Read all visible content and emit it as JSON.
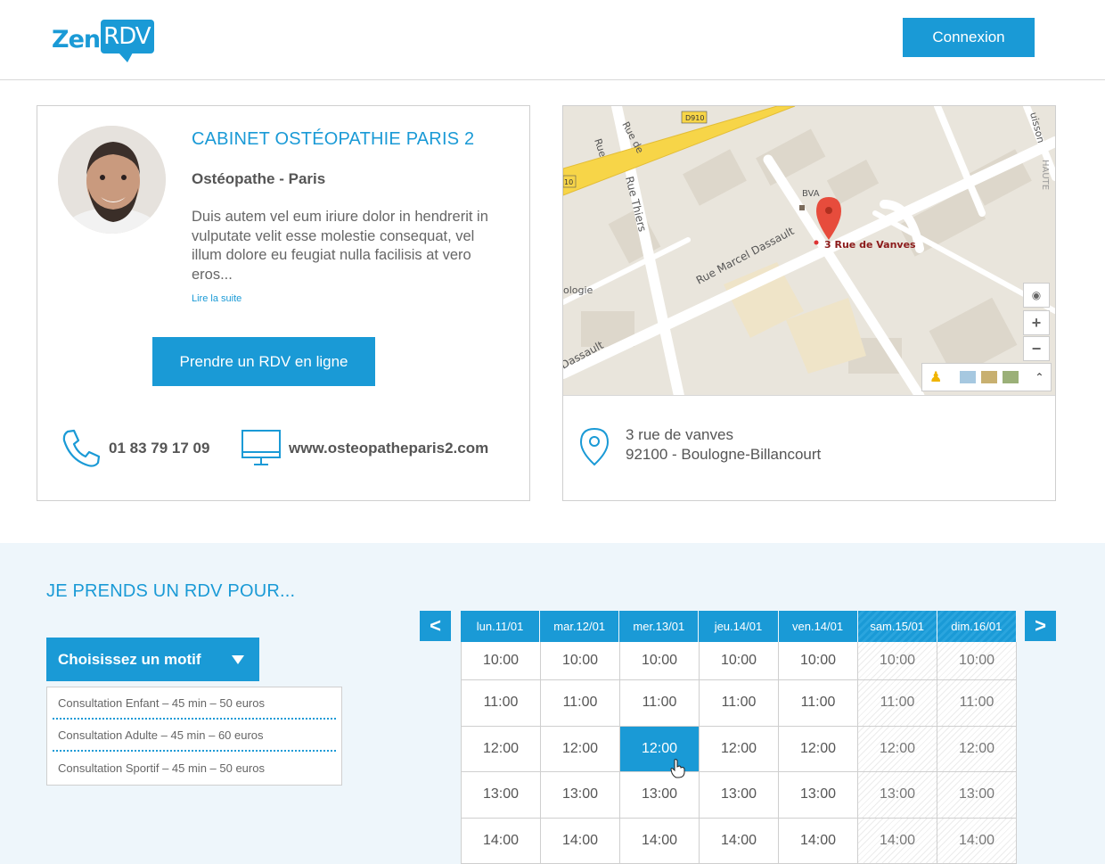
{
  "header": {
    "logo_left": "Zen",
    "logo_right": "RDV",
    "login_label": "Connexion"
  },
  "practitioner": {
    "title": "CABINET OSTÉOPATHIE PARIS 2",
    "subtitle": "Ostéopathe - Paris",
    "description": "Duis autem vel eum iriure dolor in hendrerit in vulputate velit esse molestie consequat, vel illum dolore eu feugiat nulla facilisis at vero eros...",
    "read_more": "Lire la suite",
    "book_button": "Prendre un RDV en ligne",
    "phone": "01 83 79 17 09",
    "website": "www.osteopatheparis2.com"
  },
  "map": {
    "marker_label": "3 Rue de Vanves",
    "poi_label": "BVA",
    "street_labels": [
      "Rue Thiers",
      "Rue Marcel Dassault",
      "Dassault",
      "Rue de",
      "D910",
      "10",
      "ologie",
      "uisson",
      "HAUTE"
    ],
    "zoom_in": "+",
    "zoom_out": "−"
  },
  "address": {
    "line1": "3 rue de vanves",
    "line2": "92100 - Boulogne-Billancourt"
  },
  "booking": {
    "title": "JE PRENDS UN RDV POUR...",
    "motif_label": "Choisissez un motif",
    "motifs": [
      "Consultation Enfant – 45 min – 50 euros",
      "Consultation Adulte – 45 min – 60 euros",
      "Consultation Sportif – 45 min – 50 euros"
    ],
    "prev": "<",
    "next": ">",
    "days": [
      "lun.11/01",
      "mar.12/01",
      "mer.13/01",
      "jeu.14/01",
      "ven.14/01",
      "sam.15/01",
      "dim.16/01"
    ],
    "slots": [
      "10:00",
      "11:00",
      "12:00",
      "13:00",
      "14:00"
    ],
    "weekend_columns": [
      5,
      6
    ],
    "selected": {
      "day": 2,
      "slot": 2
    }
  },
  "colors": {
    "accent": "#1a9ad6",
    "section_bg": "#eef6fb",
    "text": "#555555"
  }
}
